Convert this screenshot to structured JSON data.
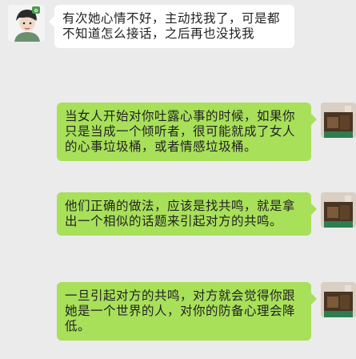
{
  "chat": {
    "incoming": [
      {
        "text": "有次她心情不好，主动找我了，可是都不知道怎么接话，之后再也没找我"
      }
    ],
    "outgoing": [
      {
        "text": "当女人开始对你吐露心事的时候，如果你只是当成一个倾听者，很可能就成了女人的心事垃圾桶，或者情感垃圾桶。"
      },
      {
        "text": "他们正确的做法，应该是找共鸣，就是拿出一个相似的话题来引起对方的共鸣。"
      },
      {
        "text": "一旦引起对方的共鸣，对方就会觉得你跟她是一个世界的人，对你的防备心理会降低。"
      }
    ]
  },
  "colors": {
    "background": "#ebebeb",
    "incoming_bubble": "#ffffff",
    "outgoing_bubble": "#a8e05a"
  }
}
